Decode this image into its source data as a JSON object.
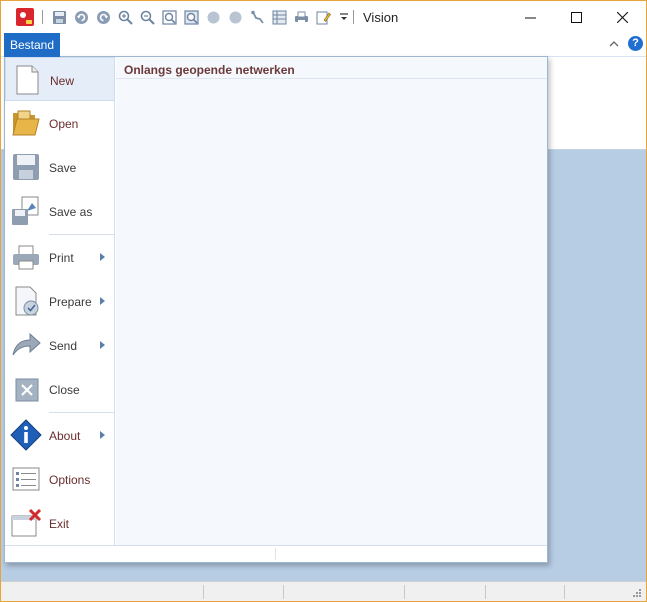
{
  "window": {
    "title": "Vision",
    "accent": "#1e6cc6",
    "border_color": "#e8a33a"
  },
  "quick_access": [
    {
      "icon": "app-logo-icon"
    },
    {
      "icon": "save-icon"
    },
    {
      "icon": "undo-icon"
    },
    {
      "icon": "redo-icon"
    },
    {
      "icon": "zoom-in-icon"
    },
    {
      "icon": "zoom-out-icon"
    },
    {
      "icon": "zoom-fit-icon"
    },
    {
      "icon": "zoom-select-icon"
    },
    {
      "icon": "circle-icon"
    },
    {
      "icon": "circle-icon"
    },
    {
      "icon": "connector-icon"
    },
    {
      "icon": "table-icon"
    },
    {
      "icon": "print-icon"
    },
    {
      "icon": "edit-icon"
    },
    {
      "icon": "customize-dropdown-icon"
    }
  ],
  "ribbon": {
    "application_tab": "Bestand",
    "help_icon": "?"
  },
  "app_menu": {
    "recent_title": "Onlangs geopende netwerken",
    "commands": [
      {
        "label": "New",
        "icon": "new-document-icon",
        "submenu": false,
        "strong": true
      },
      {
        "label": "Open",
        "icon": "open-folder-icon",
        "submenu": false,
        "strong": true
      },
      {
        "label": "Save",
        "icon": "save-disk-icon",
        "submenu": false,
        "strong": false
      },
      {
        "label": "Save as",
        "icon": "save-as-icon",
        "submenu": false,
        "strong": false
      },
      {
        "label": "Print",
        "icon": "printer-icon",
        "submenu": true,
        "strong": false
      },
      {
        "label": "Prepare",
        "icon": "prepare-icon",
        "submenu": true,
        "strong": false
      },
      {
        "label": "Send",
        "icon": "send-arrow-icon",
        "submenu": true,
        "strong": false
      },
      {
        "label": "Close",
        "icon": "close-document-icon",
        "submenu": false,
        "strong": false
      },
      {
        "label": "About",
        "icon": "info-icon",
        "submenu": true,
        "strong": true
      },
      {
        "label": "Options",
        "icon": "options-list-icon",
        "submenu": false,
        "strong": true
      },
      {
        "label": "Exit",
        "icon": "exit-icon",
        "submenu": false,
        "strong": true
      }
    ]
  }
}
